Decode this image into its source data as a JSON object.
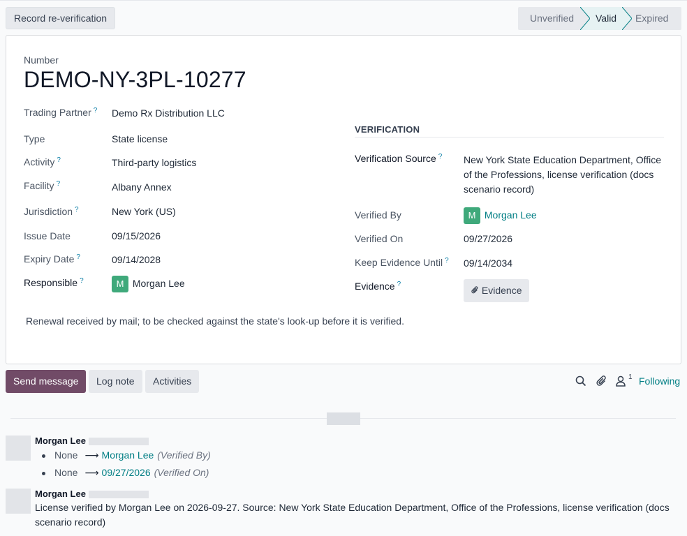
{
  "header": {
    "reverify_label": "Record re-verification",
    "stages": [
      "Unverified",
      "Valid",
      "Expired"
    ],
    "active_stage": "Valid"
  },
  "record": {
    "number_label": "Number",
    "number": "DEMO-NY-3PL-10277",
    "fields": {
      "trading_partner": {
        "label": "Trading Partner",
        "value": "Demo Rx Distribution LLC"
      },
      "type": {
        "label": "Type",
        "value": "State license"
      },
      "activity": {
        "label": "Activity",
        "value": "Third-party logistics"
      },
      "facility": {
        "label": "Facility",
        "value": "Albany Annex"
      },
      "jurisdiction": {
        "label": "Jurisdiction",
        "value": "New York (US)"
      },
      "issue_date": {
        "label": "Issue Date",
        "value": "09/15/2026"
      },
      "expiry_date": {
        "label": "Expiry Date",
        "value": "09/14/2028"
      },
      "responsible": {
        "label": "Responsible",
        "value": "Morgan Lee",
        "initial": "M"
      }
    },
    "help_mark": "?",
    "verification": {
      "title": "VERIFICATION",
      "source": {
        "label": "Verification Source",
        "value": "New York State Education Department, Office of the Professions, license verification (docs scenario record)"
      },
      "verified_by": {
        "label": "Verified By",
        "value": "Morgan Lee",
        "initial": "M"
      },
      "verified_on": {
        "label": "Verified On",
        "value": "09/27/2026"
      },
      "keep_until": {
        "label": "Keep Evidence Until",
        "value": "09/14/2034"
      },
      "evidence": {
        "label": "Evidence",
        "button": "Evidence"
      }
    },
    "note": "Renewal received by mail; to be checked against the state's look-up before it is verified."
  },
  "chatter": {
    "send_message": "Send message",
    "log_note": "Log note",
    "activities": "Activities",
    "follower_count": "1",
    "following": "Following",
    "messages": [
      {
        "author": "Morgan Lee",
        "tracking": [
          {
            "old": "None",
            "new": "Morgan Lee",
            "field": "(Verified By)"
          },
          {
            "old": "None",
            "new": "09/27/2026",
            "field": "(Verified On)"
          }
        ]
      },
      {
        "author": "Morgan Lee",
        "body": "License verified by Morgan Lee on 2026-09-27. Source: New York State Education Department, Office of the Professions, license verification (docs scenario record)"
      }
    ]
  },
  "colors": {
    "primary": "#714b67",
    "link": "#017e84",
    "avatar": "#3fa97b",
    "active_stage_bg": "#e6f2f3"
  },
  "icons": [
    "search-icon",
    "paperclip-icon",
    "user-icon",
    "arrow-right-icon"
  ]
}
